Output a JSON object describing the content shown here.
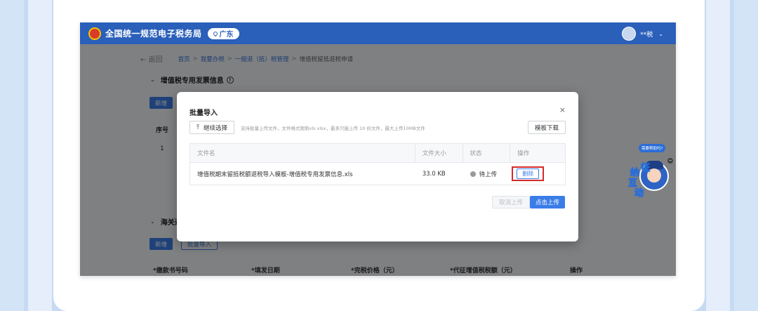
{
  "header": {
    "site_title": "全国统一规范电子税务局",
    "region": "广东",
    "user_name": "**税"
  },
  "breadcrumb": {
    "back": "← 返回",
    "items": [
      "首页",
      "我要办税",
      "一般退（抵）税管理",
      "增值税留抵退税申请"
    ]
  },
  "section1": {
    "title": "增值税专用发票信息",
    "add_label": "新增",
    "col_index": "序号",
    "row_index": "1"
  },
  "section2": {
    "title": "海关进",
    "add_label": "新增",
    "batch_label": "批量导入",
    "cols": [
      "*缴款书号码",
      "*填发日期",
      "*完税价格（元）",
      "*代征增值税税额（元）",
      "操作"
    ]
  },
  "modal": {
    "title": "批量导入",
    "close": "×",
    "continue_label": "继续选择",
    "hint": "支持批量上传文件，文件格式限制xls xlsx，最多只能上传 10 份文件，最大上传10MB文件",
    "template_label": "模板下载",
    "table": {
      "headers": [
        "文件名",
        "文件大小",
        "状态",
        "操作"
      ],
      "rows": [
        {
          "name": "增值税期末留抵税额退税导入模板-增值税专用发票信息.xls",
          "size": "33.0 KB",
          "status": "待上传",
          "action": "删除"
        }
      ]
    },
    "cancel_label": "取消上传",
    "submit_label": "点击上传"
  },
  "mascot": {
    "bubble": "需要帮助吗?",
    "chars": [
      "征",
      "纳",
      "互",
      "动"
    ],
    "minimize": "−"
  },
  "colors": {
    "primary": "#3b7de8",
    "header": "#2a5fba",
    "highlight": "#d42a2a"
  }
}
